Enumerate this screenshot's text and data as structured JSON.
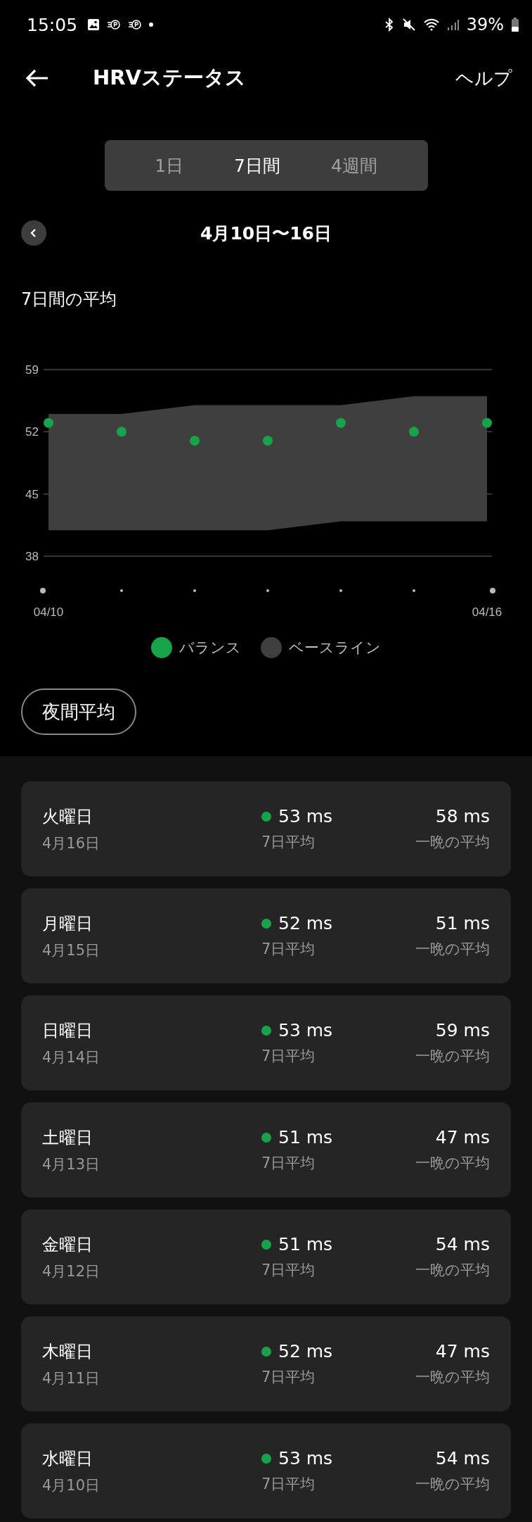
{
  "status_bar": {
    "time": "15:05",
    "battery": "39%"
  },
  "header": {
    "title": "HRVステータス",
    "help": "ヘルプ"
  },
  "tabs": [
    {
      "label": "1日",
      "selected": false
    },
    {
      "label": "7日間",
      "selected": true
    },
    {
      "label": "4週間",
      "selected": false
    }
  ],
  "date_range": "4月10日〜16日",
  "chart_title": "7日間の平均",
  "chart_data": {
    "type": "scatter",
    "categories": [
      "04/10",
      null,
      null,
      null,
      null,
      null,
      "04/16"
    ],
    "ylim": [
      38,
      59
    ],
    "yticks": [
      38,
      45,
      52,
      59
    ],
    "series": [
      {
        "name": "バランス",
        "type": "scatter",
        "color": "#17a34a",
        "values": [
          53,
          52,
          51,
          51,
          53,
          52,
          53
        ]
      },
      {
        "name": "ベースライン",
        "type": "area",
        "color": "#3f3f3f",
        "values": [
          54,
          54,
          55,
          55,
          55,
          56,
          56
        ]
      },
      {
        "type": "line",
        "color": "#3f3f3f",
        "values": [
          41,
          41,
          41,
          41,
          42,
          42,
          42
        ]
      }
    ]
  },
  "filter_button": "夜間平均",
  "days": [
    {
      "day": "火曜日",
      "date": "4月16日",
      "avg": "53 ms",
      "avg_label": "7日平均",
      "color": "#17a34a",
      "night": "58 ms",
      "night_label": "一晩の平均"
    },
    {
      "day": "月曜日",
      "date": "4月15日",
      "avg": "52 ms",
      "avg_label": "7日平均",
      "color": "#17a34a",
      "night": "51 ms",
      "night_label": "一晩の平均"
    },
    {
      "day": "日曜日",
      "date": "4月14日",
      "avg": "53 ms",
      "avg_label": "7日平均",
      "color": "#17a34a",
      "night": "59 ms",
      "night_label": "一晩の平均"
    },
    {
      "day": "土曜日",
      "date": "4月13日",
      "avg": "51 ms",
      "avg_label": "7日平均",
      "color": "#17a34a",
      "night": "47 ms",
      "night_label": "一晩の平均"
    },
    {
      "day": "金曜日",
      "date": "4月12日",
      "avg": "51 ms",
      "avg_label": "7日平均",
      "color": "#17a34a",
      "night": "54 ms",
      "night_label": "一晩の平均"
    },
    {
      "day": "木曜日",
      "date": "4月11日",
      "avg": "52 ms",
      "avg_label": "7日平均",
      "color": "#17a34a",
      "night": "47 ms",
      "night_label": "一晩の平均"
    },
    {
      "day": "水曜日",
      "date": "4月10日",
      "avg": "53 ms",
      "avg_label": "7日平均",
      "color": "#17a34a",
      "night": "54 ms",
      "night_label": "一晩の平均"
    }
  ]
}
